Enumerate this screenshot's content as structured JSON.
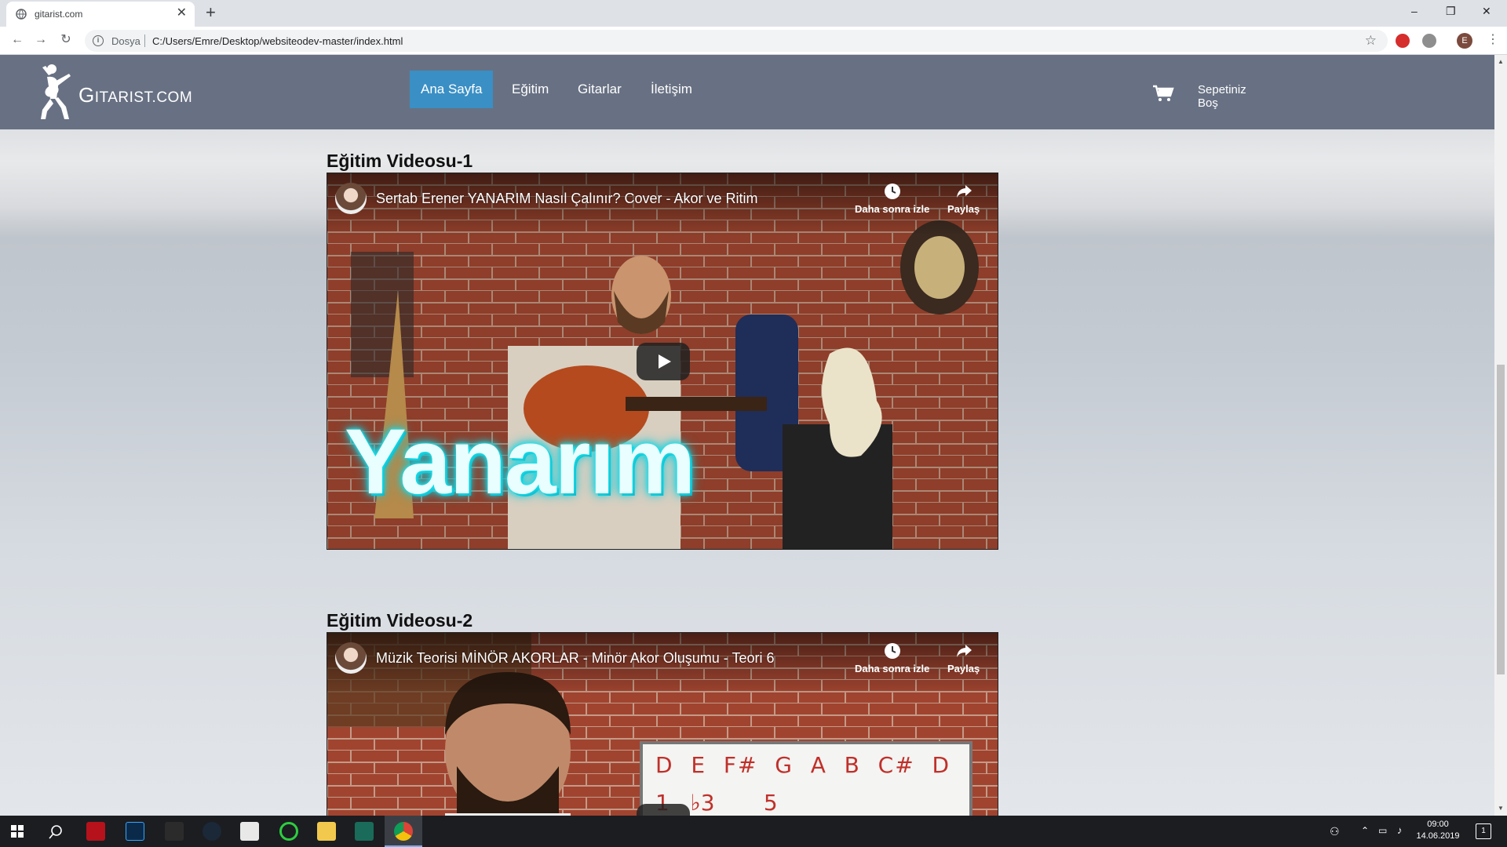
{
  "browser": {
    "tab_title": "gitarist.com",
    "tab_close": "✕",
    "new_tab": "+",
    "scheme_label": "Dosya",
    "url": "C:/Users/Emre/Desktop/websiteodev-master/index.html",
    "profile_initial": "E",
    "window_controls": {
      "minimize": "–",
      "restore": "❐",
      "close": "✕"
    }
  },
  "site": {
    "logo_text": "Gitarist.com",
    "nav": [
      "Ana Sayfa",
      "Eğitim",
      "Gitarlar",
      "İletişim"
    ],
    "active_nav": "Ana Sayfa",
    "cart": {
      "line1": "Sepetiniz",
      "line2": "Boş"
    }
  },
  "sections": [
    {
      "heading": "Eğitim Videosu-1",
      "video_title": "Sertab Erener YANARIM Nasıl Çalınır? Cover - Akor ve Ritim",
      "watch_later": "Daha sonra izle",
      "share": "Paylaş",
      "overlay_word": "Yanarım"
    },
    {
      "heading": "Eğitim Videosu-2",
      "video_title": "Müzik Teorisi MİNÖR AKORLAR - Minör Akor Oluşumu - Teori 6",
      "watch_later": "Daha sonra izle",
      "share": "Paylaş",
      "board_row1": "D  E  F#  G  A  B  C#  D",
      "board_row2": "1   ♭3       5"
    }
  ],
  "taskbar": {
    "time": "09:00",
    "date": "14.06.2019",
    "notifications": "1"
  },
  "colors": {
    "header_bg": "#687183",
    "active_nav_bg": "#3a8fc5",
    "taskbar_bg": "#1b1d21"
  }
}
